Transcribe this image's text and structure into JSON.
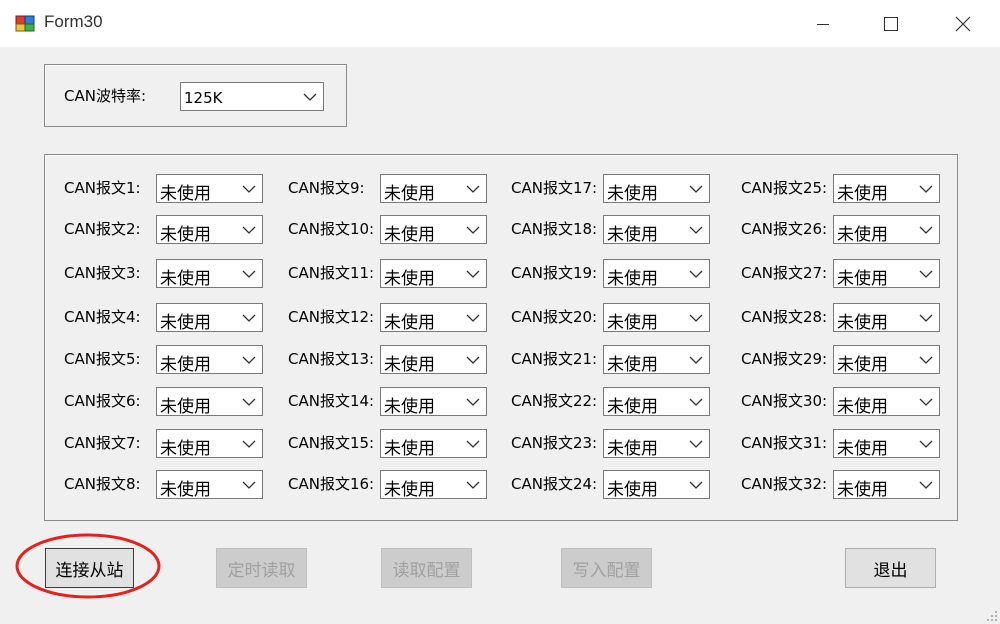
{
  "window": {
    "title": "Form30",
    "icon": "form-app-icon",
    "controls": [
      "minimize-icon",
      "maximize-icon",
      "close-icon"
    ]
  },
  "baud": {
    "label": "CAN波特率:",
    "value": "125K"
  },
  "messages": [
    {
      "label": "CAN报文1:",
      "value": "未使用"
    },
    {
      "label": "CAN报文2:",
      "value": "未使用"
    },
    {
      "label": "CAN报文3:",
      "value": "未使用"
    },
    {
      "label": "CAN报文4:",
      "value": "未使用"
    },
    {
      "label": "CAN报文5:",
      "value": "未使用"
    },
    {
      "label": "CAN报文6:",
      "value": "未使用"
    },
    {
      "label": "CAN报文7:",
      "value": "未使用"
    },
    {
      "label": "CAN报文8:",
      "value": "未使用"
    },
    {
      "label": "CAN报文9:",
      "value": "未使用"
    },
    {
      "label": "CAN报文10:",
      "value": "未使用"
    },
    {
      "label": "CAN报文11:",
      "value": "未使用"
    },
    {
      "label": "CAN报文12:",
      "value": "未使用"
    },
    {
      "label": "CAN报文13:",
      "value": "未使用"
    },
    {
      "label": "CAN报文14:",
      "value": "未使用"
    },
    {
      "label": "CAN报文15:",
      "value": "未使用"
    },
    {
      "label": "CAN报文16:",
      "value": "未使用"
    },
    {
      "label": "CAN报文17:",
      "value": "未使用"
    },
    {
      "label": "CAN报文18:",
      "value": "未使用"
    },
    {
      "label": "CAN报文19:",
      "value": "未使用"
    },
    {
      "label": "CAN报文20:",
      "value": "未使用"
    },
    {
      "label": "CAN报文21:",
      "value": "未使用"
    },
    {
      "label": "CAN报文22:",
      "value": "未使用"
    },
    {
      "label": "CAN报文23:",
      "value": "未使用"
    },
    {
      "label": "CAN报文24:",
      "value": "未使用"
    },
    {
      "label": "CAN报文25:",
      "value": "未使用"
    },
    {
      "label": "CAN报文26:",
      "value": "未使用"
    },
    {
      "label": "CAN报文27:",
      "value": "未使用"
    },
    {
      "label": "CAN报文28:",
      "value": "未使用"
    },
    {
      "label": "CAN报文29:",
      "value": "未使用"
    },
    {
      "label": "CAN报文30:",
      "value": "未使用"
    },
    {
      "label": "CAN报文31:",
      "value": "未使用"
    },
    {
      "label": "CAN报文32:",
      "value": "未使用"
    }
  ],
  "buttons": {
    "connect": "连接从站",
    "timed_read": "定时读取",
    "read_config": "读取配置",
    "write_config": "写入配置",
    "exit": "退出"
  },
  "colors": {
    "highlight": "#e8201a",
    "disabled_text": "#a0a0a0"
  }
}
